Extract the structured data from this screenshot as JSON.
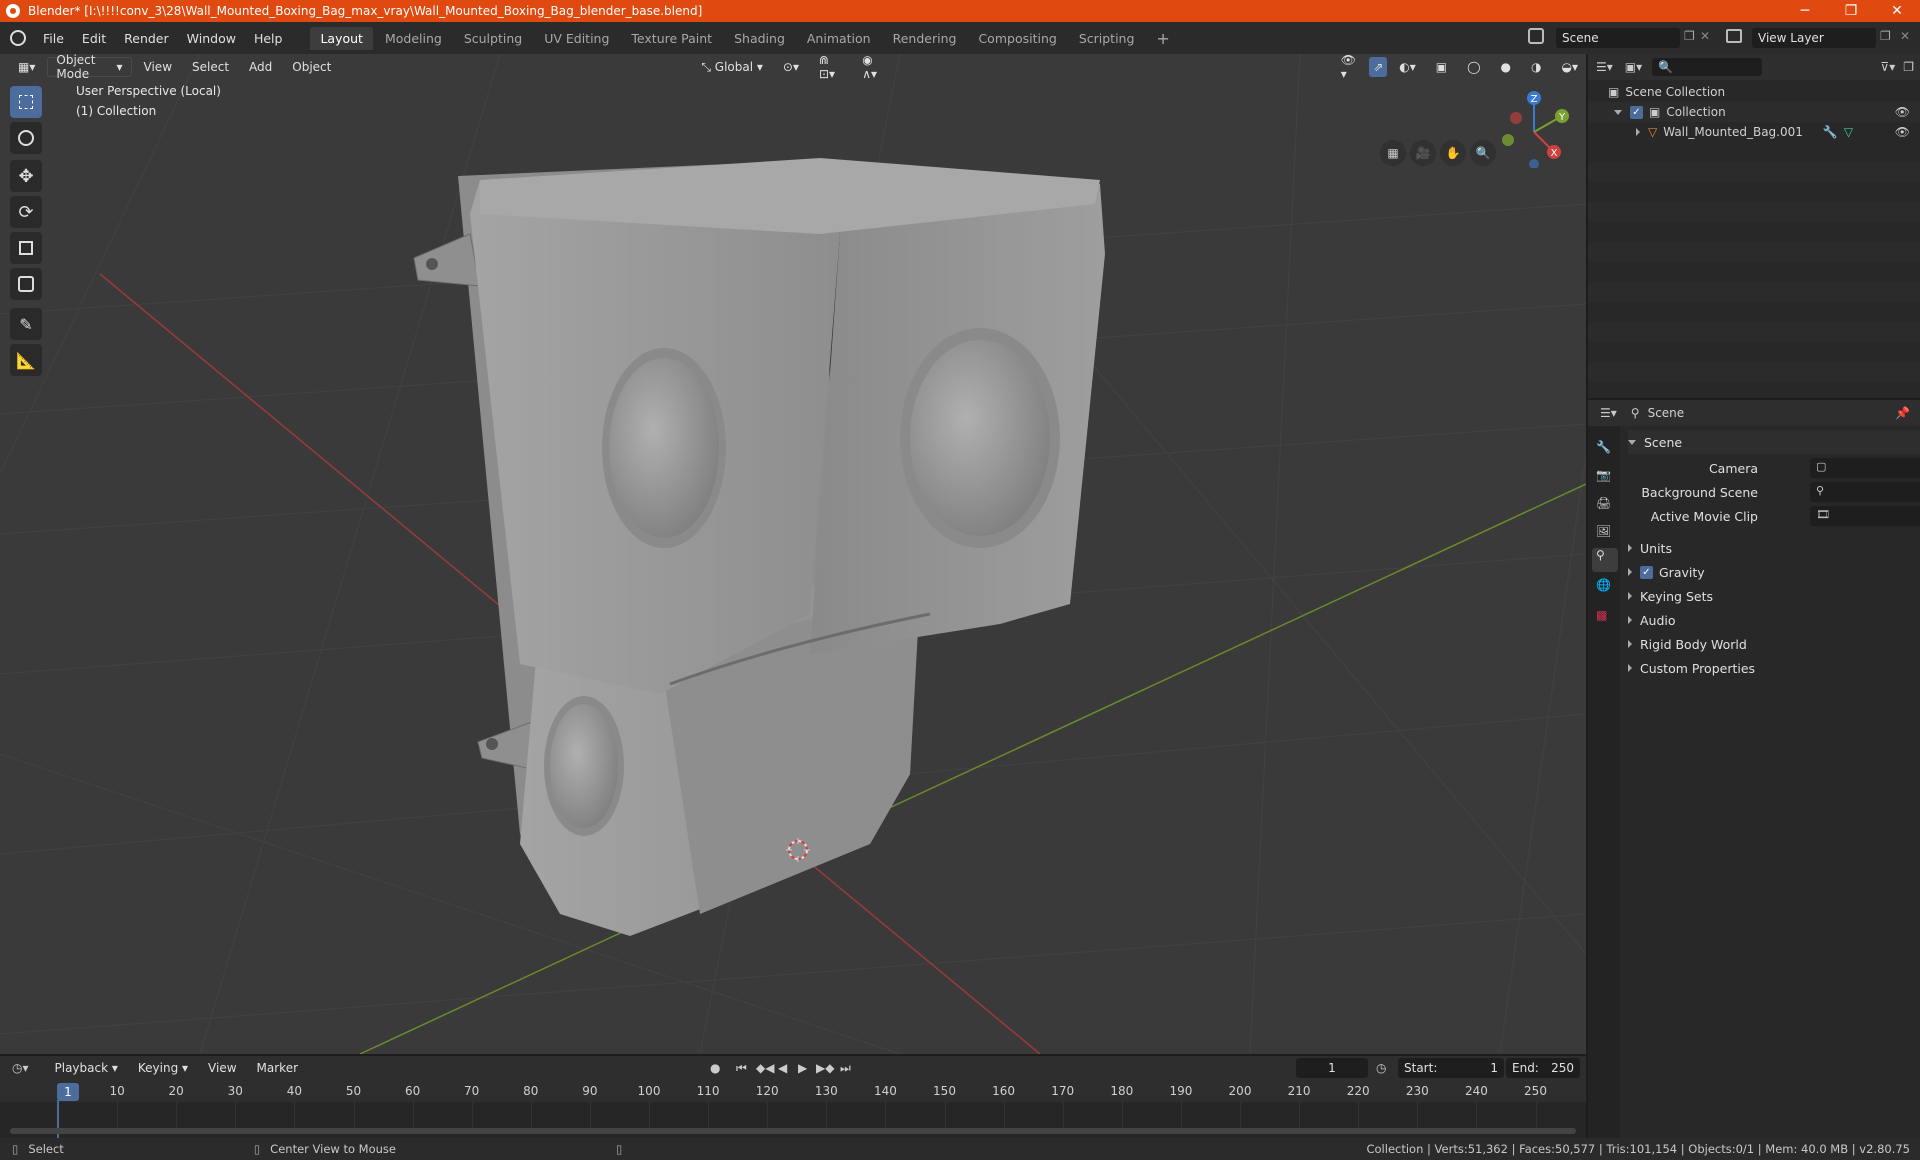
{
  "window": {
    "title": "Blender* [I:\\!!!!conv_3\\28\\Wall_Mounted_Boxing_Bag_max_vray\\Wall_Mounted_Boxing_Bag_blender_base.blend]",
    "minimize": "─",
    "restore": "❐",
    "close": "✕"
  },
  "menus": [
    "File",
    "Edit",
    "Render",
    "Window",
    "Help"
  ],
  "workspaces": [
    "Layout",
    "Modeling",
    "Sculpting",
    "UV Editing",
    "Texture Paint",
    "Shading",
    "Animation",
    "Rendering",
    "Compositing",
    "Scripting"
  ],
  "workspace_add": "+",
  "scene_field": "Scene",
  "view_layer_field": "View Layer",
  "viewport": {
    "mode": "Object Mode",
    "menus": [
      "View",
      "Select",
      "Add",
      "Object"
    ],
    "transform_orientation": "Global",
    "perspective_label": "User Perspective (Local)",
    "collection_label": "(1) Collection",
    "gizmo_axes": {
      "x": "X",
      "y": "Y",
      "z": "Z"
    }
  },
  "outliner": {
    "root": "Scene Collection",
    "collection": "Collection",
    "object": "Wall_Mounted_Bag.001"
  },
  "properties": {
    "context": "Scene",
    "section": "Scene",
    "fields": [
      {
        "label": "Camera"
      },
      {
        "label": "Background Scene"
      },
      {
        "label": "Active Movie Clip"
      }
    ],
    "panels": [
      "Units",
      "Gravity",
      "Keying Sets",
      "Audio",
      "Rigid Body World",
      "Custom Properties"
    ],
    "gravity_checked": true
  },
  "timeline": {
    "menus": [
      "Playback",
      "Keying",
      "View",
      "Marker"
    ],
    "current_frame": "1",
    "start_label": "Start:",
    "start_value": "1",
    "end_label": "End:",
    "end_value": "250",
    "ticks": [
      "10",
      "20",
      "30",
      "40",
      "50",
      "60",
      "70",
      "80",
      "90",
      "100",
      "110",
      "120",
      "130",
      "140",
      "150",
      "160",
      "170",
      "180",
      "190",
      "200",
      "210",
      "220",
      "230",
      "240",
      "250"
    ],
    "playhead": "1"
  },
  "statusbar": {
    "left": "Select",
    "middle": "Center View to Mouse",
    "stats": "Collection | Verts:51,362 | Faces:50,577 | Tris:101,154 | Objects:0/1 | Mem: 40.0 MB | v2.80.75"
  }
}
